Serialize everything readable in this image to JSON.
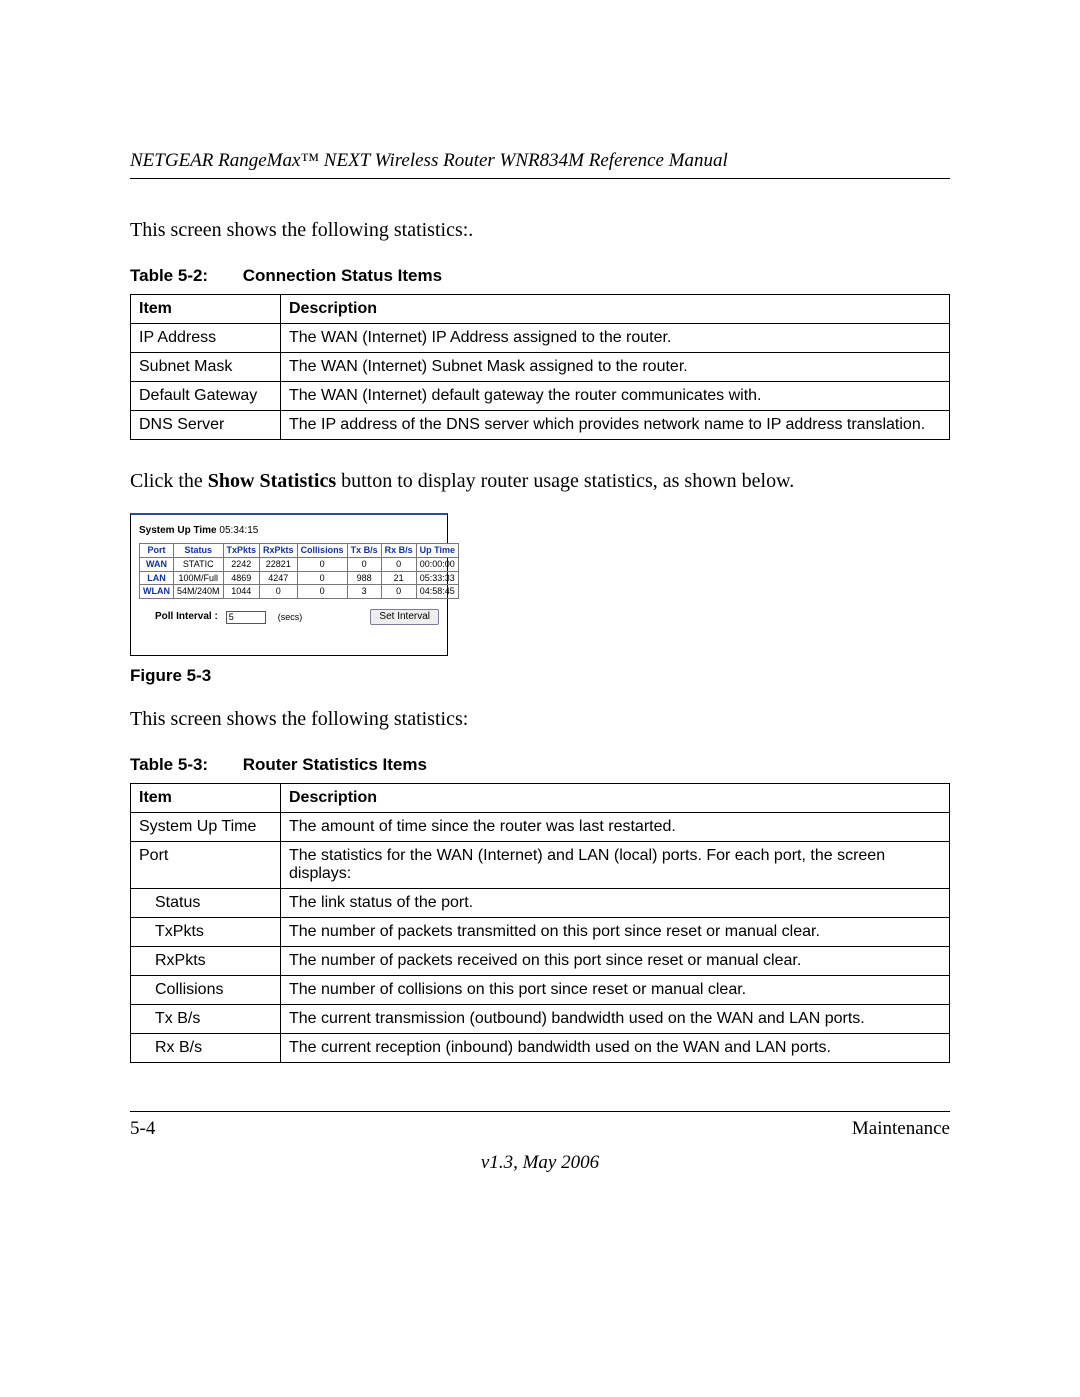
{
  "header": "NETGEAR RangeMax™ NEXT Wireless Router WNR834M Reference Manual",
  "para1": "This screen shows the following statistics:.",
  "table52": {
    "caption_label": "Table 5-2:",
    "caption_title": "Connection Status Items",
    "head_item": "Item",
    "head_desc": "Description",
    "rows": [
      {
        "item": "IP Address",
        "desc": "The WAN (Internet) IP Address assigned to the router."
      },
      {
        "item": "Subnet Mask",
        "desc": "The WAN (Internet) Subnet Mask assigned to the router."
      },
      {
        "item": "Default Gateway",
        "desc": "The WAN (Internet) default gateway the router communicates with."
      },
      {
        "item": "DNS Server",
        "desc": "The IP address of the DNS server which provides network name to IP address translation."
      }
    ]
  },
  "para2_pre": "Click the ",
  "para2_bold": "Show Statistics",
  "para2_post": " button to display router usage statistics, as shown below.",
  "widget": {
    "sysup_label": "System Up Time ",
    "sysup_value": "05:34:15",
    "cols": [
      "Port",
      "Status",
      "TxPkts",
      "RxPkts",
      "Collisions",
      "Tx B/s",
      "Rx B/s",
      "Up Time"
    ],
    "rows": [
      {
        "port": "WAN",
        "status": "STATIC",
        "tx": "2242",
        "rx": "22821",
        "col": "0",
        "txbs": "0",
        "rxbs": "0",
        "up": "00:00:00"
      },
      {
        "port": "LAN",
        "status": "100M/Full",
        "tx": "4869",
        "rx": "4247",
        "col": "0",
        "txbs": "988",
        "rxbs": "21",
        "up": "05:33:33"
      },
      {
        "port": "WLAN",
        "status": "54M/240M",
        "tx": "1044",
        "rx": "0",
        "col": "0",
        "txbs": "3",
        "rxbs": "0",
        "up": "04:58:45"
      }
    ],
    "poll_label": "Poll Interval :",
    "poll_value": "5",
    "poll_unit": "(secs)",
    "set_btn": "Set Interval"
  },
  "figure_caption": "Figure 5-3",
  "para3": "This screen shows the following statistics:",
  "table53": {
    "caption_label": "Table 5-3:",
    "caption_title": "Router Statistics Items",
    "head_item": "Item",
    "head_desc": "Description",
    "rows": [
      {
        "item": "System Up Time",
        "desc": "The amount of time since the router was last restarted.",
        "indent": false
      },
      {
        "item": "Port",
        "desc": "The statistics for the WAN (Internet) and LAN (local) ports. For each port, the screen displays:",
        "indent": false
      },
      {
        "item": "Status",
        "desc": "The link status of the port.",
        "indent": true
      },
      {
        "item": "TxPkts",
        "desc": "The number of packets transmitted on this port since reset or manual clear.",
        "indent": true
      },
      {
        "item": "RxPkts",
        "desc": "The number of packets received on this port since reset or manual clear.",
        "indent": true
      },
      {
        "item": "Collisions",
        "desc": "The number of collisions on this port since reset or manual clear.",
        "indent": true
      },
      {
        "item": "Tx B/s",
        "desc": "The current transmission (outbound) bandwidth used on the WAN and LAN ports.",
        "indent": true
      },
      {
        "item": "Rx B/s",
        "desc": "The current reception (inbound) bandwidth used on the WAN and LAN ports.",
        "indent": true
      }
    ]
  },
  "footer": {
    "page_num": "5-4",
    "section": "Maintenance",
    "version": "v1.3, May 2006"
  }
}
